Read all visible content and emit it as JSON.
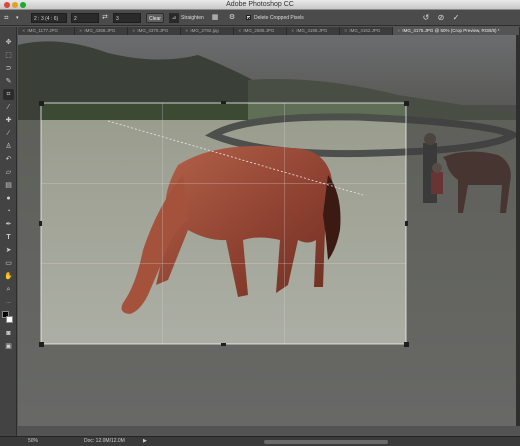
{
  "window": {
    "title": "Adobe Photoshop CC"
  },
  "options_bar": {
    "ratio_value": "2 : 3 (4 : 6)",
    "width_value": "2",
    "height_value": "3",
    "clear_label": "Clear",
    "straighten_label": "Straighten",
    "delete_cropped_label": "Delete Cropped Pixels",
    "delete_cropped_checked": true
  },
  "tabs": [
    {
      "label": "IMG_1177.JPG",
      "active": false
    },
    {
      "label": "IMG_4368.JPG",
      "active": false
    },
    {
      "label": "IMG_4370.JPG",
      "active": false
    },
    {
      "label": "IMG_2792.jpg",
      "active": false
    },
    {
      "label": "IMG_2685.JPG",
      "active": false
    },
    {
      "label": "IMG_4198.JPG",
      "active": false
    },
    {
      "label": "IMG_4162.JPG",
      "active": false
    },
    {
      "label": "IMG_4175.JPG @ 50% (Crop Preview, RGB/8) *",
      "active": true
    }
  ],
  "status": {
    "zoom": "50%",
    "doc_info": "Doc: 12.0M/12.0M"
  },
  "colors": {
    "accent": "#4a7fc1",
    "panel": "#434343",
    "canvas_bg": "#535353"
  }
}
